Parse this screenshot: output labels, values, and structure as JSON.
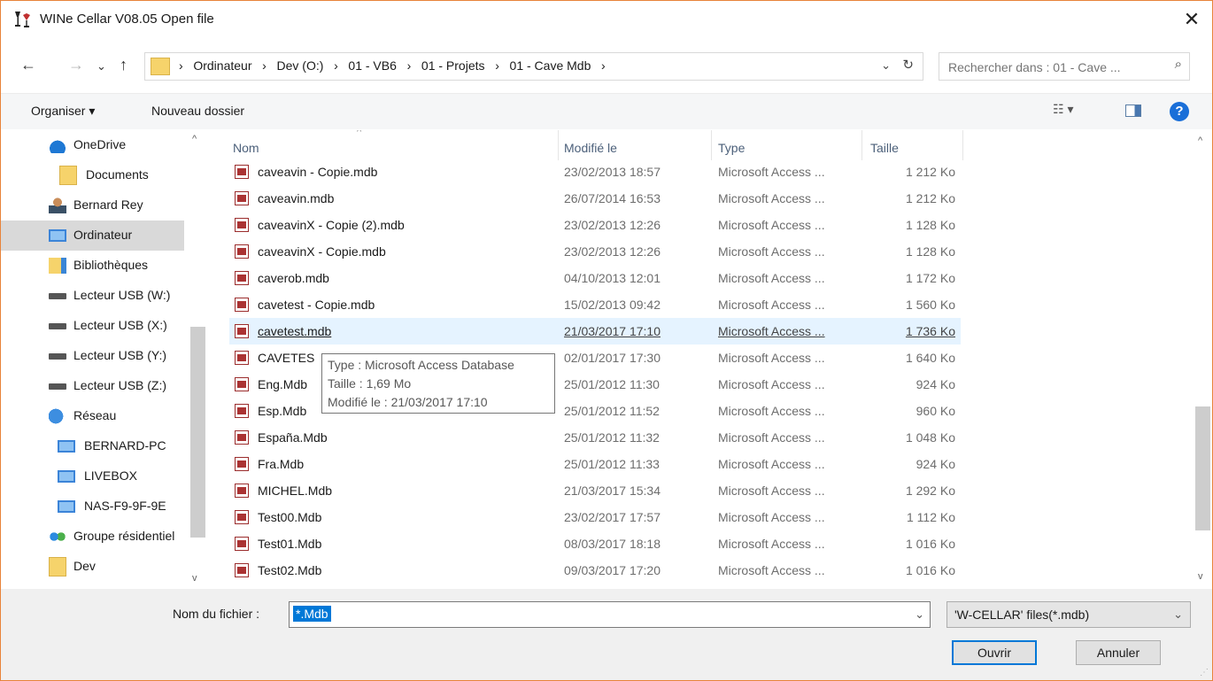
{
  "window": {
    "title": "WINe Cellar V08.05  Open file",
    "close": "✕"
  },
  "nav": {
    "back": "←",
    "forward": "→",
    "recent": "⌄",
    "up": "↑",
    "breadcrumb": [
      "Ordinateur",
      "Dev (O:)",
      "01 - VB6",
      "01 - Projets",
      "01 - Cave Mdb"
    ],
    "separator": "›",
    "dropdown": "⌄",
    "refresh": "↻",
    "search_placeholder": "Rechercher dans : 01 - Cave ...",
    "search_icon": "⌕"
  },
  "toolbar": {
    "organize": "Organiser ▾",
    "new_folder": "Nouveau dossier",
    "view_icon": "☷ ▾",
    "help": "?"
  },
  "sidebar": {
    "items": [
      {
        "label": "OneDrive",
        "icon": "cloud-icon"
      },
      {
        "label": "Documents",
        "icon": "folder-icon"
      },
      {
        "label": "Bernard Rey",
        "icon": "user-icon"
      },
      {
        "label": "Ordinateur",
        "icon": "computer-icon"
      },
      {
        "label": "Bibliothèques",
        "icon": "library-icon"
      },
      {
        "label": "Lecteur USB (W:)",
        "icon": "usb-drive-icon"
      },
      {
        "label": "Lecteur USB (X:)",
        "icon": "usb-drive-icon"
      },
      {
        "label": "Lecteur USB (Y:)",
        "icon": "usb-drive-icon"
      },
      {
        "label": "Lecteur USB (Z:)",
        "icon": "usb-drive-icon"
      },
      {
        "label": "Réseau",
        "icon": "network-icon"
      },
      {
        "label": "BERNARD-PC",
        "icon": "computer-icon"
      },
      {
        "label": "LIVEBOX",
        "icon": "computer-icon"
      },
      {
        "label": "NAS-F9-9F-9E",
        "icon": "computer-icon"
      },
      {
        "label": "Groupe résidentiel",
        "icon": "homegroup-icon"
      },
      {
        "label": "Dev",
        "icon": "folder-icon"
      }
    ],
    "selected": "Ordinateur",
    "scroll_up": "^",
    "scroll_down": "v"
  },
  "columns": {
    "name": "Nom",
    "modified": "Modifié le",
    "type": "Type",
    "size": "Taille",
    "sort_arrow": "^"
  },
  "files": [
    {
      "name": "caveavin - Copie.mdb",
      "modified": "23/02/2013 18:57",
      "type": "Microsoft Access ...",
      "size": "1 212 Ko"
    },
    {
      "name": "caveavin.mdb",
      "modified": "26/07/2014 16:53",
      "type": "Microsoft Access ...",
      "size": "1 212 Ko"
    },
    {
      "name": "caveavinX - Copie (2).mdb",
      "modified": "23/02/2013 12:26",
      "type": "Microsoft Access ...",
      "size": "1 128 Ko"
    },
    {
      "name": "caveavinX - Copie.mdb",
      "modified": "23/02/2013 12:26",
      "type": "Microsoft Access ...",
      "size": "1 128 Ko"
    },
    {
      "name": "caverob.mdb",
      "modified": "04/10/2013 12:01",
      "type": "Microsoft Access ...",
      "size": "1 172 Ko"
    },
    {
      "name": "cavetest - Copie.mdb",
      "modified": "15/02/2013 09:42",
      "type": "Microsoft Access ...",
      "size": "1 560 Ko"
    },
    {
      "name": "cavetest.mdb",
      "modified": "21/03/2017 17:10",
      "type": "Microsoft Access ...",
      "size": "1 736 Ko"
    },
    {
      "name": "CAVETES",
      "modified": "02/01/2017 17:30",
      "type": "Microsoft Access ...",
      "size": "1 640 Ko"
    },
    {
      "name": "Eng.Mdb",
      "modified": "25/01/2012 11:30",
      "type": "Microsoft Access ...",
      "size": "924 Ko"
    },
    {
      "name": "Esp.Mdb",
      "modified": "25/01/2012 11:52",
      "type": "Microsoft Access ...",
      "size": "960 Ko"
    },
    {
      "name": "España.Mdb",
      "modified": "25/01/2012 11:32",
      "type": "Microsoft Access ...",
      "size": "1 048 Ko"
    },
    {
      "name": "Fra.Mdb",
      "modified": "25/01/2012 11:33",
      "type": "Microsoft Access ...",
      "size": "924 Ko"
    },
    {
      "name": "MICHEL.Mdb",
      "modified": "21/03/2017 15:34",
      "type": "Microsoft Access ...",
      "size": "1 292 Ko"
    },
    {
      "name": "Test00.Mdb",
      "modified": "23/02/2017 17:57",
      "type": "Microsoft Access ...",
      "size": "1 112 Ko"
    },
    {
      "name": "Test01.Mdb",
      "modified": "08/03/2017 18:18",
      "type": "Microsoft Access ...",
      "size": "1 016 Ko"
    },
    {
      "name": "Test02.Mdb",
      "modified": "09/03/2017 17:20",
      "type": "Microsoft Access ...",
      "size": "1 016 Ko"
    }
  ],
  "hovered_file": "cavetest.mdb",
  "tooltip": {
    "type": "Type : Microsoft Access Database",
    "size": "Taille : 1,69 Mo",
    "modified": "Modifié le : 21/03/2017 17:10"
  },
  "bottom": {
    "filename_label": "Nom du fichier :",
    "filename_value": "*.Mdb",
    "filename_dropdown": "⌄",
    "filetype_value": "'W-CELLAR' files(*.mdb)",
    "filetype_dropdown": "⌄",
    "open_button": "Ouvrir",
    "cancel_button": "Annuler"
  },
  "colors": {
    "window_border": "#e8833a",
    "selection_blue": "#0078d7",
    "hover_row": "#e5f3ff",
    "sidebar_selected": "#d9d9d9"
  }
}
